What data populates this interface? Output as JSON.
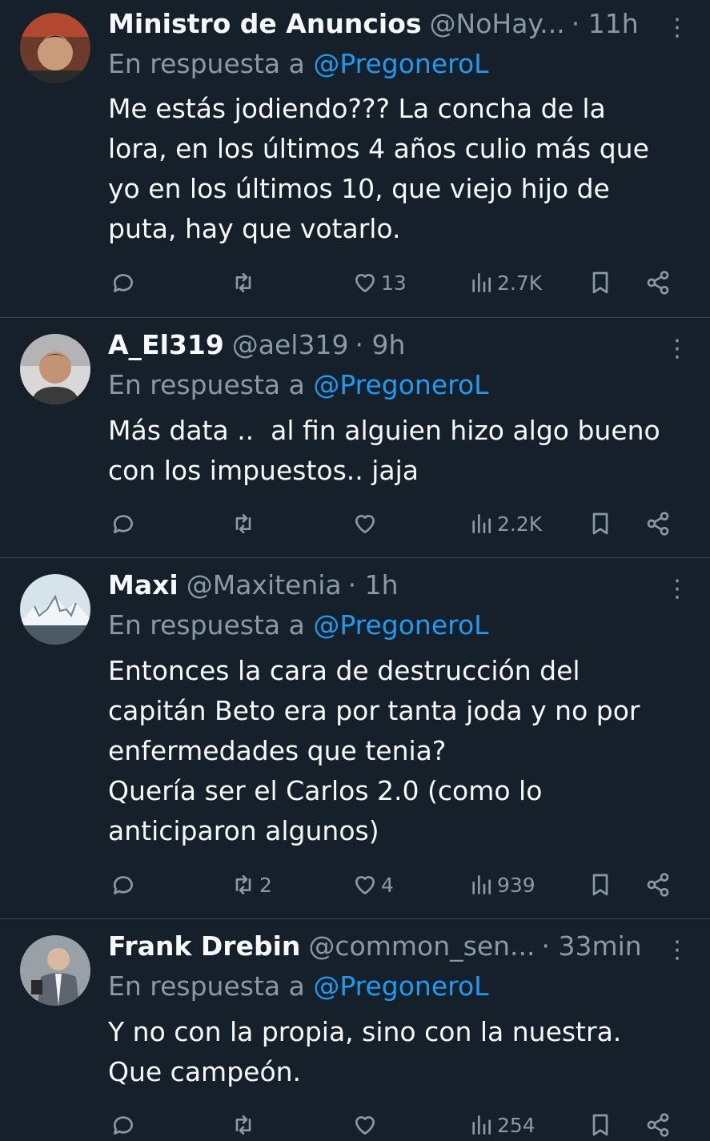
{
  "colors": {
    "background": "#15202b",
    "text": "#f7f9f9",
    "secondary": "#8b98a5",
    "accent": "#1d9bf0",
    "divider": "#38444d"
  },
  "reply_prefix": "En respuesta a",
  "tweets": [
    {
      "name": "Ministro de Anuncios",
      "handle": "@NoHay...",
      "time": "· 11h",
      "reply_to": "@PregoneroL",
      "text": "Me estás jodiendo??? La concha de la\nlora, en los últimos 4 años culio más que\nyo en los últimos 10, que viejo hijo de\nputa, hay que votarlo.",
      "replies": "",
      "retweets": "",
      "likes": "13",
      "views": "2.7K"
    },
    {
      "name": "A_El319",
      "handle": "@ael319",
      "time": "· 9h",
      "reply_to": "@PregoneroL",
      "text": "Más data ..  al fin alguien hizo algo bueno\ncon los impuestos.. jaja",
      "replies": "",
      "retweets": "",
      "likes": "",
      "views": "2.2K"
    },
    {
      "name": "Maxi",
      "handle": "@Maxitenia",
      "time": "· 1h",
      "reply_to": "@PregoneroL",
      "text": "Entonces la cara de destrucción del\ncapitán Beto era por tanta joda y no por\nenfermedades que tenia?\nQuería ser el Carlos 2.0 (como lo\nanticiparon algunos)",
      "replies": "",
      "retweets": "2",
      "likes": "4",
      "views": "939"
    },
    {
      "name": "Frank Drebin",
      "handle": "@common_sen...",
      "time": "· 33min",
      "reply_to": "@PregoneroL",
      "text": "Y no con la propia, sino con la nuestra.\nQue campeón.",
      "replies": "",
      "retweets": "",
      "likes": "",
      "views": "254"
    }
  ]
}
